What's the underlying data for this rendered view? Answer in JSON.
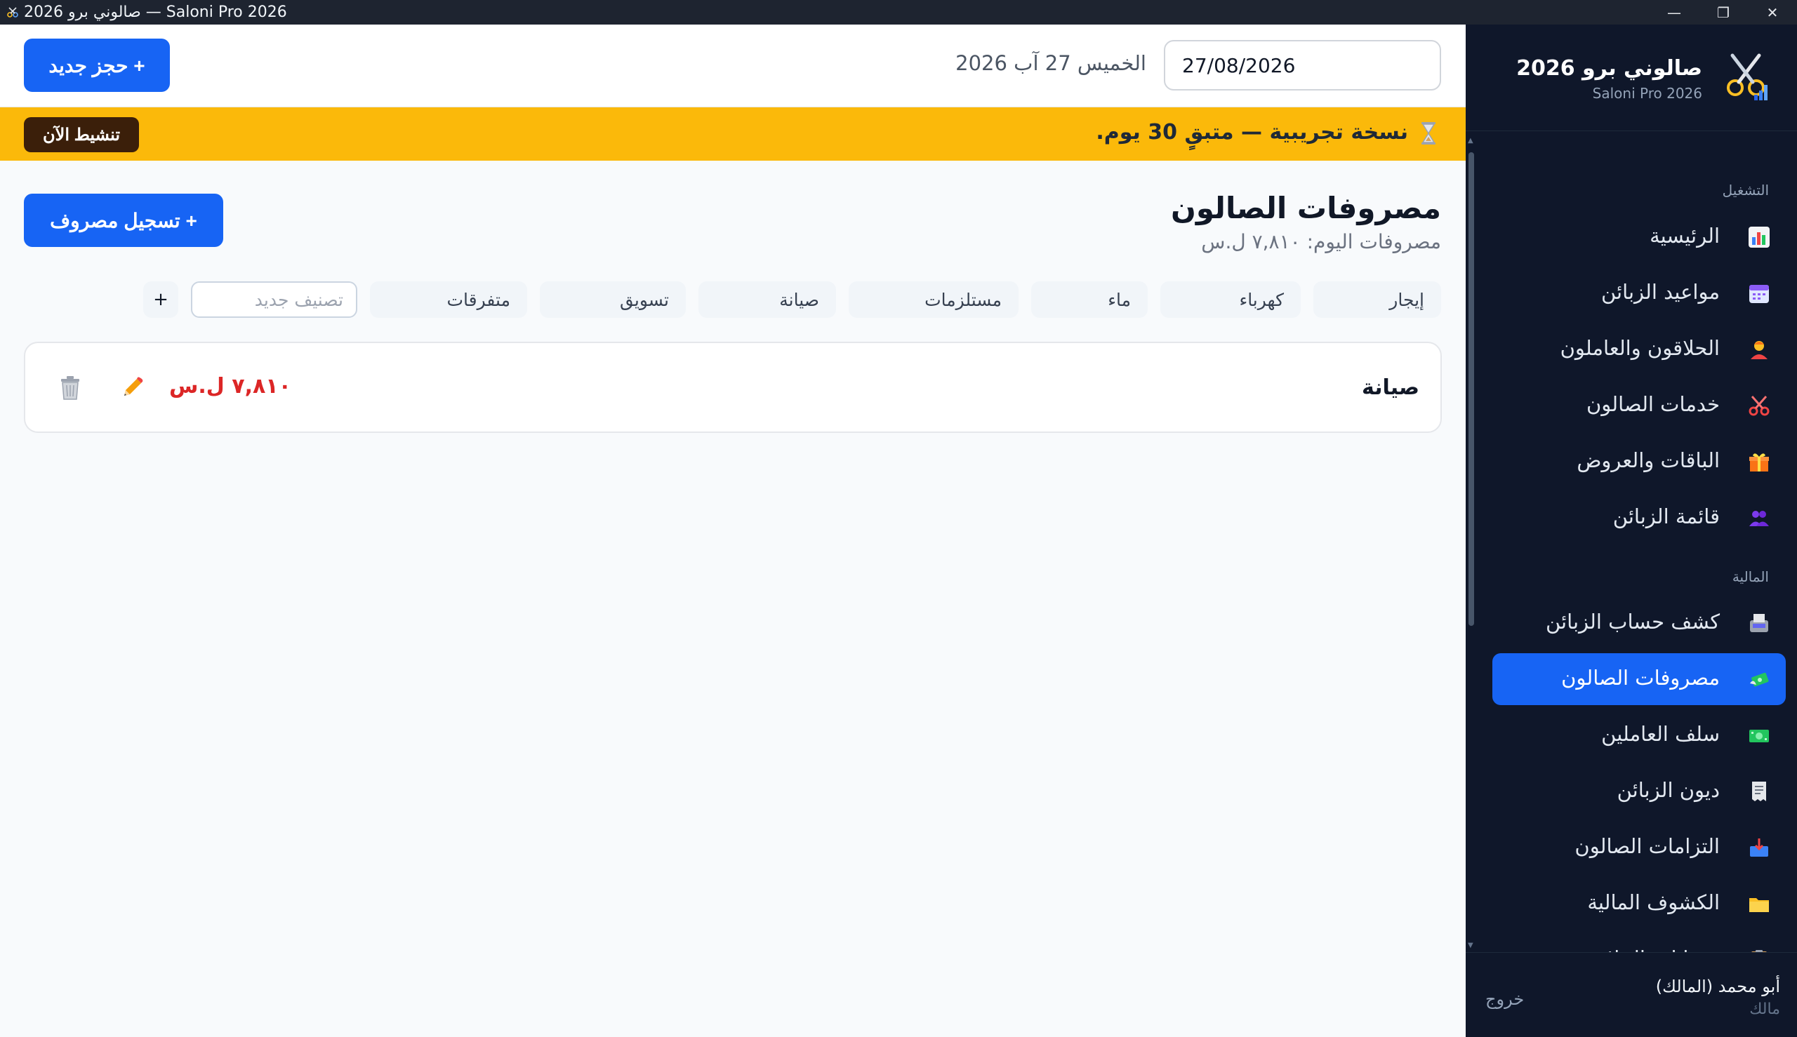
{
  "window": {
    "title": "صالوني برو 2026 — Saloni Pro 2026",
    "minimize_glyph": "—",
    "maximize_glyph": "❐",
    "close_glyph": "✕"
  },
  "topbar": {
    "date_value": "27/08/2026",
    "date_text": "الخميس 27 آب 2026",
    "new_booking_label": "+ حجز جديد"
  },
  "trial": {
    "icon": "hourglass-icon",
    "message": "نسخة تجريبية — متبقٍ 30 يوم.",
    "activate_label": "تنشيط الآن"
  },
  "page": {
    "title": "مصروفات الصالون",
    "subtitle": "مصروفات اليوم: ٧,٨١٠ ل.س",
    "add_expense_label": "+ تسجيل مصروف"
  },
  "categories": [
    "إيجار",
    "كهرباء",
    "ماء",
    "مستلزمات",
    "صيانة",
    "تسويق",
    "متفرقات"
  ],
  "new_category": {
    "placeholder": "تصنيف جديد",
    "add_label": "+"
  },
  "expenses": [
    {
      "category": "صيانة",
      "amount": "٧,٨١٠ ل.س"
    }
  ],
  "sidebar": {
    "brand_name": "صالوني برو 2026",
    "brand_sub": "Saloni Pro 2026",
    "sections": [
      {
        "label": "التشغيل",
        "items": [
          {
            "label": "الرئيسية",
            "icon": "chart-icon"
          },
          {
            "label": "مواعيد الزبائن",
            "icon": "calendar-icon"
          },
          {
            "label": "الحلاقون والعاملون",
            "icon": "barber-icon"
          },
          {
            "label": "خدمات الصالون",
            "icon": "scissors-icon"
          },
          {
            "label": "الباقات والعروض",
            "icon": "gift-icon"
          },
          {
            "label": "قائمة الزبائن",
            "icon": "users-icon"
          }
        ]
      },
      {
        "label": "المالية",
        "items": [
          {
            "label": "كشف حساب الزبائن",
            "icon": "fax-icon"
          },
          {
            "label": "مصروفات الصالون",
            "icon": "money-wings-icon",
            "active": true
          },
          {
            "label": "سلف العاملين",
            "icon": "banknote-icon"
          },
          {
            "label": "ديون الزبائن",
            "icon": "receipt-icon"
          },
          {
            "label": "التزامات الصالون",
            "icon": "inbox-icon"
          },
          {
            "label": "الكشوف المالية",
            "icon": "folder-icon"
          },
          {
            "label": "حسابات الحلاقين",
            "icon": "clipboard-icon"
          }
        ]
      }
    ]
  },
  "user": {
    "name": "أبو محمد (المالك)",
    "role": "مالك",
    "logout_label": "خروج"
  },
  "colors": {
    "primary": "#1764f4",
    "trial_banner": "#fbb90a",
    "sidebar_bg": "#0f172a",
    "amount_red": "#dc2626"
  }
}
